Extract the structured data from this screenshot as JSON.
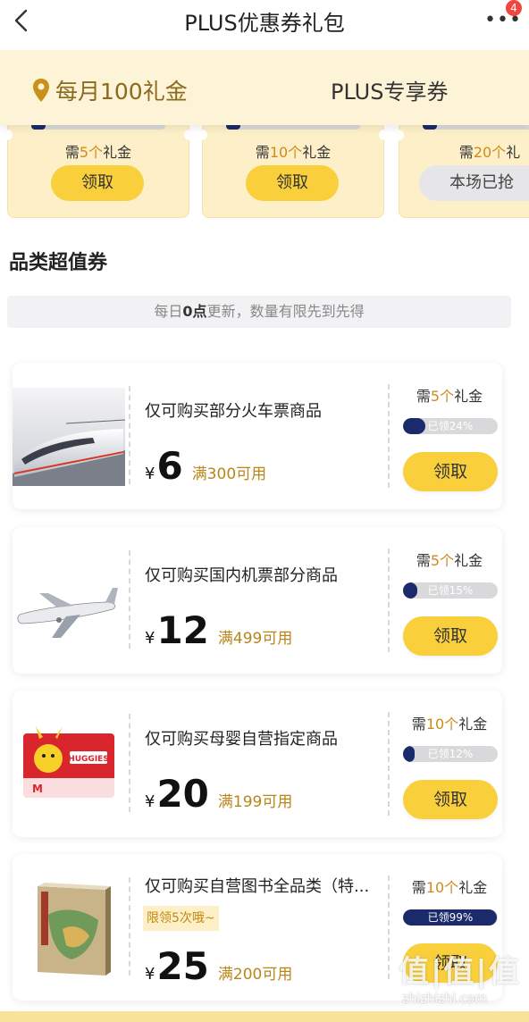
{
  "header": {
    "title": "PLUS优惠券礼包",
    "badge_count": "4"
  },
  "tabs": [
    {
      "label": "每月100礼金"
    },
    {
      "label": "PLUS专享券"
    }
  ],
  "top_coupons": [
    {
      "need_prefix": "需",
      "need_num": "5个",
      "need_suffix": "礼金",
      "button": "领取"
    },
    {
      "need_prefix": "需",
      "need_num": "10个",
      "need_suffix": "礼金",
      "button": "领取"
    },
    {
      "need_prefix": "需",
      "need_num": "20个",
      "need_suffix": "礼",
      "button": "本场已抢"
    }
  ],
  "section": {
    "title": "品类超值券",
    "notice_prefix": "每日",
    "notice_bold": "0点",
    "notice_suffix": "更新，数量有限先到先得"
  },
  "coupons": [
    {
      "desc": "仅可购买部分火车票商品",
      "currency": "¥",
      "value": "6",
      "condition": "满300可用",
      "need_prefix": "需",
      "need_num": "5个",
      "need_suffix": "礼金",
      "claimed_label": "已领24%",
      "claimed_pct": 24,
      "button": "领取",
      "image": "train-image"
    },
    {
      "desc": "仅可购买国内机票部分商品",
      "currency": "¥",
      "value": "12",
      "condition": "满499可用",
      "need_prefix": "需",
      "need_num": "5个",
      "need_suffix": "礼金",
      "claimed_label": "已领15%",
      "claimed_pct": 15,
      "button": "领取",
      "image": "airplane-image"
    },
    {
      "desc": "仅可购买母婴自营指定商品",
      "currency": "¥",
      "value": "20",
      "condition": "满199可用",
      "need_prefix": "需",
      "need_num": "10个",
      "need_suffix": "礼金",
      "claimed_label": "已领12%",
      "claimed_pct": 12,
      "button": "领取",
      "image": "diaper-image"
    },
    {
      "desc": "仅可购买自营图书全品类（特...",
      "limit": "限领5次哦~",
      "currency": "¥",
      "value": "25",
      "condition": "满200可用",
      "need_prefix": "需",
      "need_num": "10个",
      "need_suffix": "礼金",
      "claimed_label": "已领99%",
      "claimed_pct": 99,
      "button": "领取",
      "image": "book-image"
    }
  ],
  "watermark": {
    "logo": "值|值|值",
    "url": "zhizhizhi.com"
  },
  "colors": {
    "accent": "#f9cf3b",
    "progress": "#1b2a6b",
    "gold_text": "#b8861a",
    "tab_bg": "#fdf3d6"
  }
}
